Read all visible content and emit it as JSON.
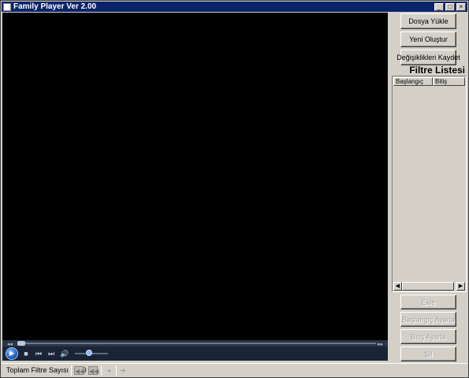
{
  "window": {
    "title": "Family Player Ver 2.00",
    "minimize_glyph": "_",
    "maximize_glyph": "□",
    "close_glyph": "×"
  },
  "player": {
    "seek_position": 0,
    "volume_level": 0.4,
    "icons": [
      "play-icon",
      "stop-icon",
      "previous-icon",
      "next-icon",
      "volume-icon"
    ]
  },
  "sidebar": {
    "buttons": {
      "load_file": "Dosya Yükle",
      "create_new": "Yeni Oluştur",
      "save_changes": "Değişiklikleri Kaydet"
    },
    "filter_title": "Filtre Listesi",
    "columns": [
      "Başlangıç",
      "Bitiş"
    ],
    "rows": [],
    "actions": {
      "add": "Ekle",
      "set_start": "Başlangıç Ayarla",
      "set_end": "Bitiş Ayarla",
      "delete": "Sil"
    }
  },
  "status": {
    "filter_count": "Toplam Filtre Sayısı : 000"
  },
  "colors": {
    "titlebar": "#0a246a",
    "video_bg": "#000000",
    "controls_bg": "#1a2436",
    "window_bg": "#d4d0c8"
  }
}
